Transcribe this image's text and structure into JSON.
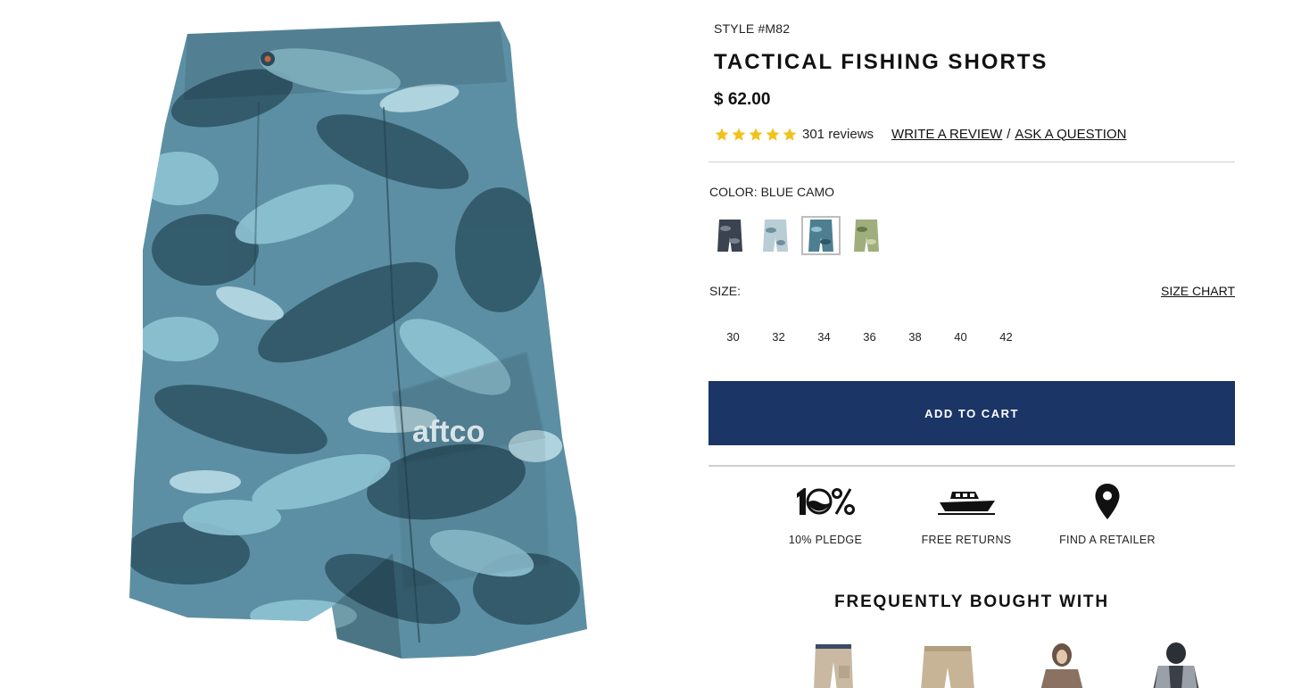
{
  "product": {
    "style": "STYLE #M82",
    "title": "TACTICAL FISHING SHORTS",
    "price": "$ 62.00",
    "rating": {
      "stars": 5,
      "reviews_label": "301 reviews"
    },
    "write_review": "WRITE A REVIEW",
    "separator": "/",
    "ask_question": "ASK A QUESTION",
    "image_logo_text": "aftco"
  },
  "color": {
    "label": "COLOR: BLUE CAMO",
    "selected_index": 2,
    "swatches": [
      {
        "name": "dark-camo",
        "base": "#3c4350",
        "accent": "#7a8290"
      },
      {
        "name": "light-blue-camo",
        "base": "#b9cdd6",
        "accent": "#6f8f9d"
      },
      {
        "name": "blue-camo",
        "base": "#4d7f91",
        "accent": "#8fc1cf"
      },
      {
        "name": "green-camo",
        "base": "#9fae7c",
        "accent": "#687a4c"
      }
    ]
  },
  "size": {
    "label": "SIZE:",
    "chart_link": "SIZE CHART",
    "options": [
      "30",
      "32",
      "34",
      "36",
      "38",
      "40",
      "42"
    ]
  },
  "cart": {
    "button_label": "ADD TO CART",
    "color": "#1b3566"
  },
  "perks": [
    {
      "icon": "ten-percent-icon",
      "label": "10% PLEDGE"
    },
    {
      "icon": "boat-icon",
      "label": "FREE RETURNS"
    },
    {
      "icon": "map-pin-icon",
      "label": "FIND A RETAILER"
    }
  ],
  "frequently_bought": {
    "title": "FREQUENTLY BOUGHT WITH",
    "items": [
      {
        "icon": "khaki-pants-icon"
      },
      {
        "icon": "tan-shorts-icon"
      },
      {
        "icon": "brown-hoodie-icon"
      },
      {
        "icon": "jacket-icon"
      }
    ]
  },
  "colors": {
    "star": "#f2c21b",
    "button": "#1b3566",
    "rule": "#cfcfcf"
  }
}
